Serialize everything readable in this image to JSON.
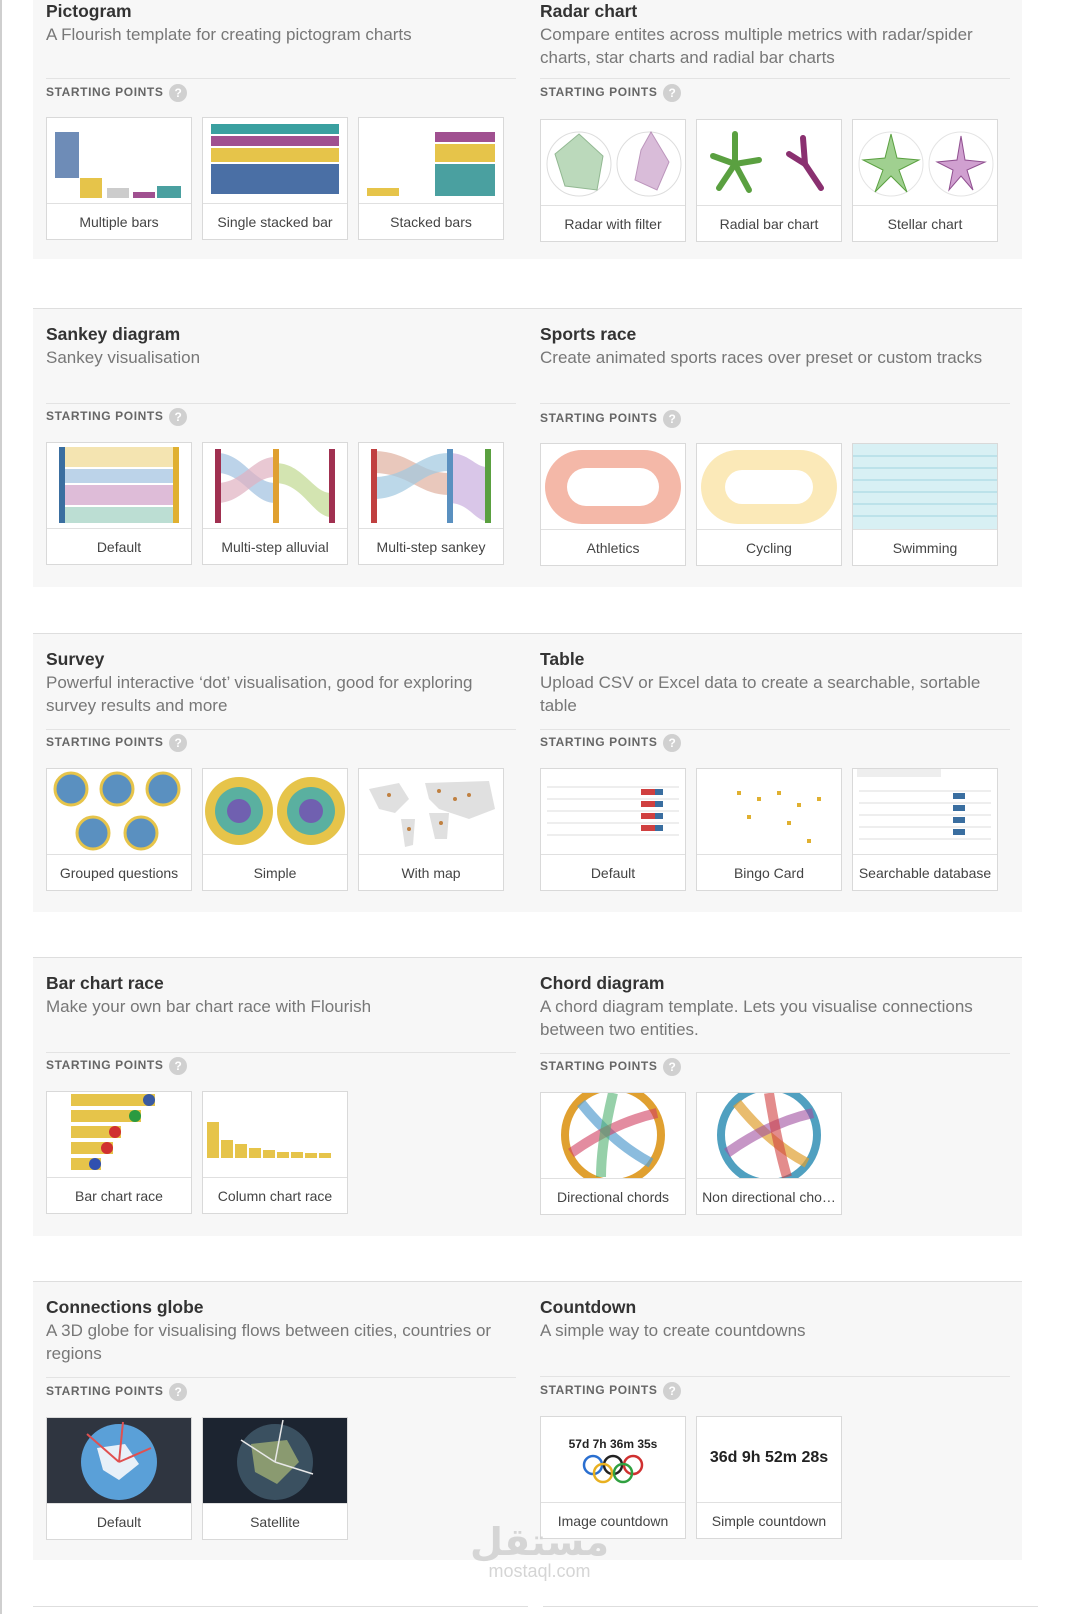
{
  "starting_points_label": "STARTING POINTS",
  "help_glyph": "?",
  "cards": [
    {
      "title": "Pictogram",
      "desc": "A Flourish template for creating pictogram charts",
      "thumbs": [
        {
          "label": "Multiple bars",
          "icon": "pictogram-multiple-bars-thumbnail"
        },
        {
          "label": "Single stacked bar",
          "icon": "pictogram-single-stacked-thumbnail"
        },
        {
          "label": "Stacked bars",
          "icon": "pictogram-stacked-bars-thumbnail"
        }
      ]
    },
    {
      "title": "Radar chart",
      "desc": "Compare entites across multiple metrics with radar/spider charts, star charts and radial bar charts",
      "thumbs": [
        {
          "label": "Radar with filter",
          "icon": "radar-filter-thumbnail"
        },
        {
          "label": "Radial bar chart",
          "icon": "radial-bar-thumbnail"
        },
        {
          "label": "Stellar chart",
          "icon": "stellar-chart-thumbnail"
        }
      ]
    },
    {
      "title": "Sankey diagram",
      "desc": "Sankey visualisation",
      "thumbs": [
        {
          "label": "Default",
          "icon": "sankey-default-thumbnail"
        },
        {
          "label": "Multi-step alluvial",
          "icon": "alluvial-thumbnail"
        },
        {
          "label": "Multi-step sankey",
          "icon": "multistep-sankey-thumbnail"
        }
      ]
    },
    {
      "title": "Sports race",
      "desc": "Create animated sports races over preset or custom tracks",
      "thumbs": [
        {
          "label": "Athletics",
          "icon": "athletics-track-thumbnail"
        },
        {
          "label": "Cycling",
          "icon": "cycling-track-thumbnail"
        },
        {
          "label": "Swimming",
          "icon": "swimming-pool-thumbnail"
        }
      ]
    },
    {
      "title": "Survey",
      "desc": "Powerful interactive ‘dot’ visualisation, good for exploring survey results and more",
      "thumbs": [
        {
          "label": "Grouped questions",
          "icon": "survey-grouped-thumbnail"
        },
        {
          "label": "Simple",
          "icon": "survey-simple-thumbnail"
        },
        {
          "label": "With map",
          "icon": "survey-map-thumbnail"
        }
      ]
    },
    {
      "title": "Table",
      "desc": "Upload CSV or Excel data to create a searchable, sortable table",
      "thumbs": [
        {
          "label": "Default",
          "icon": "table-default-thumbnail"
        },
        {
          "label": "Bingo Card",
          "icon": "bingo-card-thumbnail"
        },
        {
          "label": "Searchable database",
          "icon": "searchable-db-thumbnail"
        }
      ]
    },
    {
      "title": "Bar chart race",
      "desc": "Make your own bar chart race with Flourish",
      "thumbs": [
        {
          "label": "Bar chart race",
          "icon": "bar-race-thumbnail"
        },
        {
          "label": "Column chart race",
          "icon": "column-race-thumbnail"
        }
      ]
    },
    {
      "title": "Chord diagram",
      "desc": "A chord diagram template. Lets you visualise connections between two entities.",
      "thumbs": [
        {
          "label": "Directional chords",
          "icon": "chord-directional-thumbnail"
        },
        {
          "label": "Non directional cho…",
          "icon": "chord-nondirectional-thumbnail"
        }
      ]
    },
    {
      "title": "Connections globe",
      "desc": "A 3D globe for visualising flows between cities, countries or regions",
      "thumbs": [
        {
          "label": "Default",
          "icon": "globe-default-thumbnail"
        },
        {
          "label": "Satellite",
          "icon": "globe-satellite-thumbnail"
        }
      ]
    },
    {
      "title": "Countdown",
      "desc": "A simple way to create countdowns",
      "thumbs": [
        {
          "label": "Image countdown",
          "icon": "countdown-image-thumbnail",
          "text": "57d 7h 36m 35s"
        },
        {
          "label": "Simple countdown",
          "icon": "countdown-simple-thumbnail",
          "text": "36d 9h 52m 28s"
        }
      ]
    }
  ],
  "watermark": {
    "arabic": "مستقل",
    "latin": "mostaql.com"
  },
  "colors": {
    "card_bg": "#f7f7f7",
    "title": "#333333",
    "desc": "#777777",
    "thumb_border": "#d9d9d9"
  }
}
